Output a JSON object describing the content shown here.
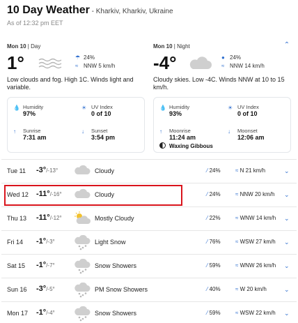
{
  "header": {
    "title": "10 Day Weather",
    "location": " - Kharkiv, Kharkiv, Ukraine",
    "as_of": "As of 12:32 pm EET"
  },
  "today": {
    "day": {
      "date": "Mon 10",
      "period": " | Day",
      "temp": "1°",
      "icon": "fog-icon",
      "precip": "24%",
      "wind": "NNW 5 km/h",
      "summary": "Low clouds and fog. High 1C. Winds light and variable.",
      "humidity_label": "Humidity",
      "humidity": "97%",
      "uv_label": "UV Index",
      "uv": "0 of 10",
      "sunrise_label": "Sunrise",
      "sunrise": "7:31 am",
      "sunset_label": "Sunset",
      "sunset": "3:54 pm"
    },
    "night": {
      "date": "Mon 10",
      "period": " | Night",
      "temp": "-4°",
      "icon": "cloud-icon",
      "precip": "24%",
      "wind": "NNW 14 km/h",
      "summary": "Cloudy skies. Low -4C. Winds NNW at 10 to 15 km/h.",
      "humidity_label": "Humidity",
      "humidity": "93%",
      "uv_label": "UV Index",
      "uv": "0 of 10",
      "moonrise_label": "Moonrise",
      "moonrise": "11:24 am",
      "moonset_label": "Moonset",
      "moonset": "12:06 am",
      "moon_phase": "Waxing Gibbous"
    }
  },
  "forecast": [
    {
      "day": "Tue 11",
      "hi": "-3°",
      "lo": "/-13°",
      "icon": "cloud-icon",
      "cond": "Cloudy",
      "precip": "24%",
      "wind": "N 21 km/h"
    },
    {
      "day": "Wed 12",
      "hi": "-11°",
      "lo": "/-16°",
      "icon": "cloud-icon",
      "cond": "Cloudy",
      "precip": "24%",
      "wind": "NNW 20 km/h"
    },
    {
      "day": "Thu 13",
      "hi": "-11°",
      "lo": "/-12°",
      "icon": "partly-cloudy-icon",
      "cond": "Mostly Cloudy",
      "precip": "22%",
      "wind": "WNW 14 km/h"
    },
    {
      "day": "Fri 14",
      "hi": "-1°",
      "lo": "/-3°",
      "icon": "snow-icon",
      "cond": "Light Snow",
      "precip": "76%",
      "wind": "WSW 27 km/h"
    },
    {
      "day": "Sat 15",
      "hi": "-1°",
      "lo": "/-7°",
      "icon": "snow-icon",
      "cond": "Snow Showers",
      "precip": "59%",
      "wind": "WNW 26 km/h"
    },
    {
      "day": "Sun 16",
      "hi": "-3°",
      "lo": "/-5°",
      "icon": "snow-icon",
      "cond": "PM Snow Showers",
      "precip": "40%",
      "wind": "W 20 km/h"
    },
    {
      "day": "Mon 17",
      "hi": "-1°",
      "lo": "/-4°",
      "icon": "snow-icon",
      "cond": "Snow Showers",
      "precip": "59%",
      "wind": "WSW 22 km/h"
    }
  ],
  "colors": {
    "accent": "#2f6fcf",
    "highlight": "#d9141c"
  }
}
